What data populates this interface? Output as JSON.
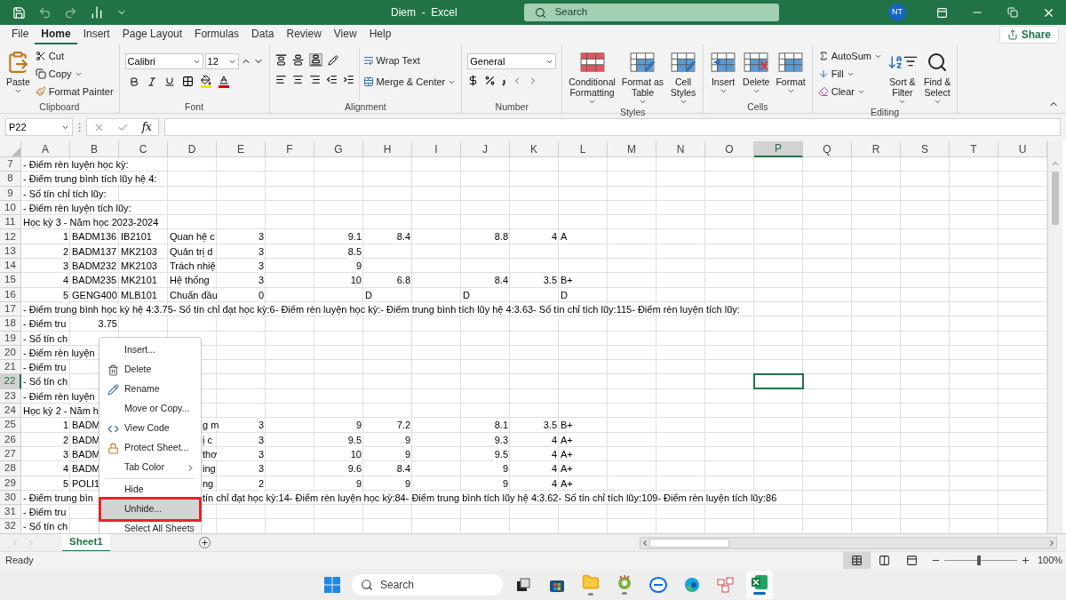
{
  "title_bar": {
    "title": "Diem  -  Excel",
    "search": {
      "placeholder": "Search"
    },
    "avatar": "NT"
  },
  "tabs": [
    {
      "label": "File",
      "selected": false
    },
    {
      "label": "Home",
      "selected": true
    },
    {
      "label": "Insert",
      "selected": false
    },
    {
      "label": "Page Layout",
      "selected": false
    },
    {
      "label": "Formulas",
      "selected": false
    },
    {
      "label": "Data",
      "selected": false
    },
    {
      "label": "Review",
      "selected": false
    },
    {
      "label": "View",
      "selected": false
    },
    {
      "label": "Help",
      "selected": false
    }
  ],
  "share": "Share",
  "ribbon": {
    "clipboard": {
      "label": "Clipboard",
      "paste": "Paste",
      "cut": "Cut",
      "copy": "Copy",
      "format_painter": "Format Painter"
    },
    "font": {
      "label": "Font",
      "name": "Calibri",
      "size": "12"
    },
    "alignment": {
      "label": "Alignment",
      "wrap_text": "Wrap Text",
      "merge": "Merge & Center"
    },
    "number": {
      "label": "Number",
      "format": "General"
    },
    "styles": {
      "label": "Styles",
      "buttons": [
        {
          "kind": "conditional",
          "lines": [
            "Conditional",
            "Formatting"
          ]
        },
        {
          "kind": "table",
          "lines": [
            "Format as",
            "Table"
          ]
        },
        {
          "kind": "cellstyle",
          "lines": [
            "Cell",
            "Styles"
          ]
        }
      ]
    },
    "cells": {
      "label": "Cells",
      "buttons": [
        {
          "kind": "insert",
          "label": "Insert"
        },
        {
          "kind": "delete",
          "label": "Delete"
        },
        {
          "kind": "format",
          "label": "Format"
        }
      ]
    },
    "editing": {
      "label": "Editing",
      "autosum": "AutoSum",
      "fill": "Fill",
      "clear": "Clear",
      "sort": [
        "Sort &",
        "Filter"
      ],
      "find": [
        "Find &",
        "Select"
      ]
    }
  },
  "formula_bar": {
    "name_box": "P22",
    "function_label": "fx"
  },
  "columns": [
    {
      "label": "A",
      "selected": false
    },
    {
      "label": "B",
      "selected": false
    },
    {
      "label": "C",
      "selected": false
    },
    {
      "label": "D",
      "selected": false
    },
    {
      "label": "E",
      "selected": false
    },
    {
      "label": "F",
      "selected": false
    },
    {
      "label": "G",
      "selected": false
    },
    {
      "label": "H",
      "selected": false
    },
    {
      "label": "I",
      "selected": false
    },
    {
      "label": "J",
      "selected": false
    },
    {
      "label": "K",
      "selected": false
    },
    {
      "label": "L",
      "selected": false
    },
    {
      "label": "M",
      "selected": false
    },
    {
      "label": "N",
      "selected": false
    },
    {
      "label": "O",
      "selected": false
    },
    {
      "label": "P",
      "selected": true
    },
    {
      "label": "Q",
      "selected": false
    },
    {
      "label": "R",
      "selected": false
    },
    {
      "label": "S",
      "selected": false
    },
    {
      "label": "T",
      "selected": false
    },
    {
      "label": "U",
      "selected": false
    }
  ],
  "rows": [
    {
      "number": "7",
      "selected": false,
      "cells": [
        {
          "kind": "text",
          "text": "- Điểm rèn luyện học kỳ:"
        }
      ]
    },
    {
      "number": "8",
      "selected": false,
      "cells": [
        {
          "kind": "text",
          "text": "- Điểm trung bình tích lũy hệ 4:"
        }
      ]
    },
    {
      "number": "9",
      "selected": false,
      "cells": [
        {
          "kind": "text",
          "text": "- Số tín chỉ tích lũy:"
        }
      ]
    },
    {
      "number": "10",
      "selected": false,
      "cells": [
        {
          "kind": "text",
          "text": "- Điểm rèn luyện tích lũy:"
        }
      ]
    },
    {
      "number": "11",
      "selected": false,
      "cells": [
        {
          "kind": "text",
          "text": "Học kỳ 3 - Năm học 2023-2024"
        }
      ]
    },
    {
      "number": "12",
      "selected": false,
      "cells": [
        {
          "kind": "number",
          "text": "1"
        },
        {
          "kind": "text",
          "text": "BADM136"
        },
        {
          "kind": "text",
          "text": "IB2101"
        },
        {
          "kind": "text",
          "text": "Quan hệ c"
        },
        {
          "kind": "number",
          "text": "3"
        },
        null,
        {
          "kind": "number",
          "text": "9.1"
        },
        {
          "kind": "number",
          "text": "8.4"
        },
        null,
        {
          "kind": "number",
          "text": "8.8"
        },
        {
          "kind": "number",
          "text": "4"
        },
        {
          "kind": "text",
          "text": "A"
        }
      ]
    },
    {
      "number": "13",
      "selected": false,
      "cells": [
        {
          "kind": "number",
          "text": "2"
        },
        {
          "kind": "text",
          "text": "BADM137"
        },
        {
          "kind": "text",
          "text": "MK2103"
        },
        {
          "kind": "text",
          "text": "Quản trị d"
        },
        {
          "kind": "number",
          "text": "3"
        },
        null,
        {
          "kind": "number",
          "text": "8.5"
        }
      ]
    },
    {
      "number": "14",
      "selected": false,
      "cells": [
        {
          "kind": "number",
          "text": "3"
        },
        {
          "kind": "text",
          "text": "BADM232"
        },
        {
          "kind": "text",
          "text": "MK2103"
        },
        {
          "kind": "text",
          "text": "Trách nhiệ"
        },
        {
          "kind": "number",
          "text": "3"
        },
        null,
        {
          "kind": "number",
          "text": "9"
        }
      ]
    },
    {
      "number": "15",
      "selected": false,
      "cells": [
        {
          "kind": "number",
          "text": "4"
        },
        {
          "kind": "text",
          "text": "BADM235"
        },
        {
          "kind": "text",
          "text": "MK2101"
        },
        {
          "kind": "text",
          "text": "Hệ thống"
        },
        {
          "kind": "number",
          "text": "3"
        },
        null,
        {
          "kind": "number",
          "text": "10"
        },
        {
          "kind": "number",
          "text": "6.8"
        },
        null,
        {
          "kind": "number",
          "text": "8.4"
        },
        {
          "kind": "number",
          "text": "3.5"
        },
        {
          "kind": "text",
          "text": "B+"
        }
      ]
    },
    {
      "number": "16",
      "selected": false,
      "cells": [
        {
          "kind": "number",
          "text": "5"
        },
        {
          "kind": "text",
          "text": "GENG400"
        },
        {
          "kind": "text",
          "text": "MLB101"
        },
        {
          "kind": "text",
          "text": "Chuẩn đầu"
        },
        {
          "kind": "number",
          "text": "0"
        },
        null,
        null,
        {
          "kind": "text",
          "text": "D"
        },
        null,
        {
          "kind": "text",
          "text": "D"
        },
        null,
        {
          "kind": "text",
          "text": "D"
        }
      ]
    },
    {
      "number": "17",
      "selected": false,
      "cells": [
        {
          "kind": "text",
          "text": "- Điểm trung bình học kỳ hệ 4:3.75- Số tín chỉ đạt học kỳ:6- Điểm rèn luyện học kỳ:- Điểm trung bình tích lũy hệ 4:3.63- Số tín chỉ tích lũy:115- Điểm rèn luyện tích lũy:"
        }
      ]
    },
    {
      "number": "18",
      "selected": false,
      "cells": [
        {
          "kind": "text",
          "text": "- Điểm tru"
        },
        {
          "kind": "number",
          "text": "3.75"
        }
      ]
    },
    {
      "number": "19",
      "selected": false,
      "cells": [
        {
          "kind": "text",
          "text": "- Số tín ch"
        }
      ]
    },
    {
      "number": "20",
      "selected": false,
      "cells": [
        {
          "kind": "text",
          "text": "- Điểm rèn luyện"
        }
      ]
    },
    {
      "number": "21",
      "selected": false,
      "cells": [
        {
          "kind": "text",
          "text": "- Điểm tru"
        }
      ]
    },
    {
      "number": "22",
      "selected": true,
      "cells": [
        {
          "kind": "text",
          "text": "- Số tín ch"
        }
      ]
    },
    {
      "number": "23",
      "selected": false,
      "cells": [
        {
          "kind": "text",
          "text": "- Điểm rèn luyện"
        }
      ]
    },
    {
      "number": "24",
      "selected": false,
      "cells": [
        {
          "kind": "text",
          "text": "Học kỳ 2 - Năm h"
        }
      ]
    },
    {
      "number": "25",
      "selected": false,
      "cells": [
        {
          "kind": "number",
          "text": "1"
        },
        {
          "kind": "text",
          "text": "BADM"
        },
        null,
        {
          "kind": "after_menu",
          "text": "g m"
        },
        {
          "kind": "number",
          "text": "3"
        },
        null,
        {
          "kind": "number",
          "text": "9"
        },
        {
          "kind": "number",
          "text": "7.2"
        },
        null,
        {
          "kind": "number",
          "text": "8.1"
        },
        {
          "kind": "number",
          "text": "3.5"
        },
        {
          "kind": "text",
          "text": "B+"
        }
      ]
    },
    {
      "number": "26",
      "selected": false,
      "cells": [
        {
          "kind": "number",
          "text": "2"
        },
        {
          "kind": "text",
          "text": "BADM"
        },
        null,
        {
          "kind": "after_menu",
          "text": "ị c"
        },
        {
          "kind": "number",
          "text": "3"
        },
        null,
        {
          "kind": "number",
          "text": "9.5"
        },
        {
          "kind": "number",
          "text": "9"
        },
        null,
        {
          "kind": "number",
          "text": "9.3"
        },
        {
          "kind": "number",
          "text": "4"
        },
        {
          "kind": "text",
          "text": "A+"
        }
      ]
    },
    {
      "number": "27",
      "selected": false,
      "cells": [
        {
          "kind": "number",
          "text": "3"
        },
        {
          "kind": "text",
          "text": "BADM"
        },
        null,
        {
          "kind": "after_menu",
          "text": "thơ"
        },
        {
          "kind": "number",
          "text": "3"
        },
        null,
        {
          "kind": "number",
          "text": "10"
        },
        {
          "kind": "number",
          "text": "9"
        },
        null,
        {
          "kind": "number",
          "text": "9.5"
        },
        {
          "kind": "number",
          "text": "4"
        },
        {
          "kind": "text",
          "text": "A+"
        }
      ]
    },
    {
      "number": "28",
      "selected": false,
      "cells": [
        {
          "kind": "number",
          "text": "4"
        },
        {
          "kind": "text",
          "text": "BADM"
        },
        null,
        {
          "kind": "after_menu",
          "text": "ing"
        },
        {
          "kind": "number",
          "text": "3"
        },
        null,
        {
          "kind": "number",
          "text": "9.6"
        },
        {
          "kind": "number",
          "text": "8.4"
        },
        null,
        {
          "kind": "number",
          "text": "9"
        },
        {
          "kind": "number",
          "text": "4"
        },
        {
          "kind": "text",
          "text": "A+"
        }
      ]
    },
    {
      "number": "29",
      "selected": false,
      "cells": [
        {
          "kind": "number",
          "text": "5"
        },
        {
          "kind": "text",
          "text": "POLI1"
        },
        null,
        {
          "kind": "after_menu",
          "text": "ng"
        },
        {
          "kind": "number",
          "text": "2"
        },
        null,
        {
          "kind": "number",
          "text": "9"
        },
        {
          "kind": "number",
          "text": "9"
        },
        null,
        {
          "kind": "number",
          "text": "9"
        },
        {
          "kind": "number",
          "text": "4"
        },
        {
          "kind": "text",
          "text": "A+"
        }
      ]
    },
    {
      "number": "30",
      "selected": false,
      "cells": [
        {
          "kind": "text",
          "text": "- Điểm trung bìn"
        },
        null,
        null,
        {
          "kind": "after_menu",
          "text": "tín chỉ đạt học kỳ:14- Điểm rèn luyện học kỳ:84- Điểm trung bình tích lũy hệ 4:3.62- Số tín chỉ tích lũy:109- Điểm rèn luyện tích lũy:86"
        }
      ]
    },
    {
      "number": "31",
      "selected": false,
      "cells": [
        {
          "kind": "text",
          "text": "- Điểm tru"
        }
      ]
    },
    {
      "number": "32",
      "selected": false,
      "cells": [
        {
          "kind": "text",
          "text": "- Số tín ch"
        }
      ]
    }
  ],
  "context_menu": {
    "items": [
      {
        "kind": "insert",
        "label": "Insert...",
        "selected": false
      },
      {
        "kind": "delete",
        "label": "Delete",
        "selected": false
      },
      {
        "kind": "rename",
        "label": "Rename",
        "selected": false
      },
      {
        "kind": "move",
        "label": "Move or Copy...",
        "selected": false
      },
      {
        "kind": "code",
        "label": "View Code",
        "selected": false
      },
      {
        "kind": "protect",
        "label": "Protect Sheet...",
        "selected": false
      },
      {
        "kind": "submenu",
        "label": "Tab Color",
        "selected": false
      },
      {
        "kind": "separated",
        "label": "Hide",
        "selected": false
      },
      {
        "kind": "plain",
        "label": "Unhide...",
        "selected": true
      },
      {
        "kind": "plain",
        "label": "Select All Sheets",
        "selected": false
      }
    ]
  },
  "sheets": [
    {
      "label": "Sheet1",
      "selected": true
    }
  ],
  "status_bar": {
    "status": "Ready",
    "views": [
      {
        "kind": "normal",
        "selected": true
      },
      {
        "kind": "layout",
        "selected": false
      },
      {
        "kind": "pagebreak",
        "selected": false
      }
    ],
    "zoom": {
      "level": 0.47,
      "reading": "100%"
    }
  },
  "taskbar": {
    "search": {
      "placeholder": "Search"
    },
    "apps": [
      {
        "kind": "taskview",
        "running": false,
        "active": false
      },
      {
        "kind": "store",
        "running": false,
        "active": false
      },
      {
        "kind": "folder",
        "running": true,
        "active": false
      },
      {
        "kind": "browser",
        "running": true,
        "active": false
      },
      {
        "kind": "chat",
        "running": false,
        "active": false
      },
      {
        "kind": "edge",
        "running": false,
        "active": false
      },
      {
        "kind": "tiles",
        "running": false,
        "active": false
      },
      {
        "kind": "excel",
        "running": true,
        "active": true
      }
    ]
  }
}
